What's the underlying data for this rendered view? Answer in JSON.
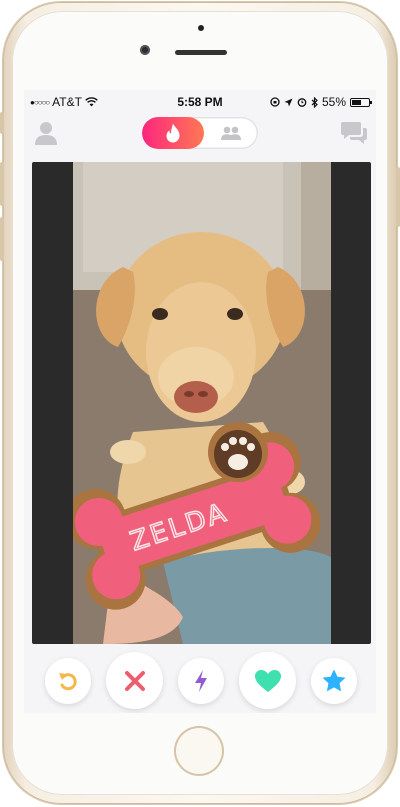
{
  "status_bar": {
    "signal": "●○○○○",
    "carrier": "AT&T",
    "time": "5:58 PM",
    "battery_percent": "55%",
    "battery_level": 0.55
  },
  "header": {
    "left_icon": "profile-icon",
    "toggle_active_icon": "flame-icon",
    "toggle_inactive_icon": "group-icon",
    "right_icon": "chat-icon",
    "accent_gradient": [
      "#fd267d",
      "#ff7854"
    ]
  },
  "card": {
    "photo_description_icon": "dog-photo",
    "cookie_text": "ZELDA"
  },
  "actions": [
    {
      "name": "rewind-button",
      "icon": "rewind-icon",
      "color": "#f5b748"
    },
    {
      "name": "nope-button",
      "icon": "close-icon",
      "color": "#ec5e6f"
    },
    {
      "name": "boost-button",
      "icon": "bolt-icon",
      "color": "#915dd1"
    },
    {
      "name": "like-button",
      "icon": "heart-icon",
      "color": "#3ee0b0"
    },
    {
      "name": "super-like-button",
      "icon": "star-icon",
      "color": "#2db2ff"
    }
  ]
}
